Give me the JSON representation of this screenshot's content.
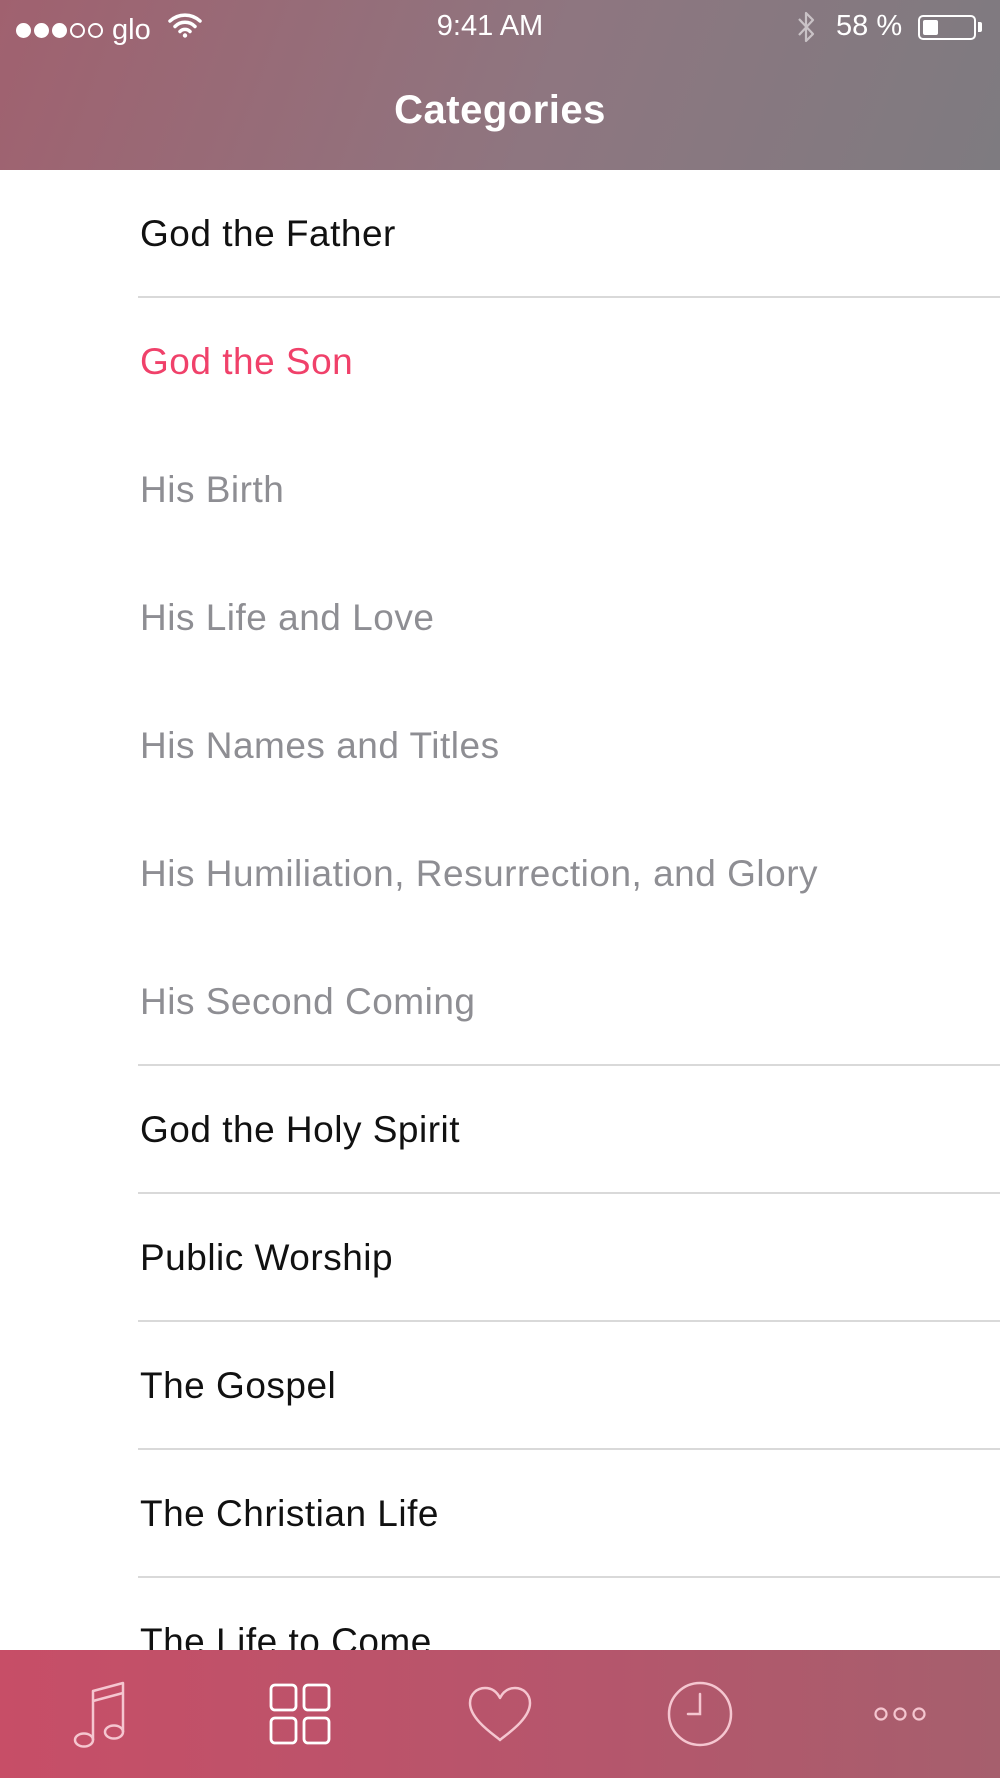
{
  "status_bar": {
    "carrier": "glo",
    "time": "9:41 AM",
    "battery_percent": "58 %",
    "battery_level": 0.58,
    "signal_strength": 3,
    "signal_max": 5
  },
  "header": {
    "title": "Categories"
  },
  "categories": [
    {
      "label": "God the Father"
    },
    {
      "label": "God the Son",
      "selected": true
    },
    {
      "label": "His Birth",
      "subcategory": true
    },
    {
      "label": "His Life and Love",
      "subcategory": true
    },
    {
      "label": "His Names and Titles",
      "subcategory": true
    },
    {
      "label": "His Humiliation, Resurrection, and Glory",
      "subcategory": true
    },
    {
      "label": "His Second Coming",
      "subcategory": true
    },
    {
      "label": "God the Holy Spirit"
    },
    {
      "label": "Public Worship"
    },
    {
      "label": "The Gospel"
    },
    {
      "label": "The Christian Life"
    },
    {
      "label": "The Life to Come"
    }
  ],
  "tab_bar": {
    "items": [
      {
        "icon": "music-note-icon"
      },
      {
        "icon": "grid-icon",
        "active": true
      },
      {
        "icon": "heart-icon"
      },
      {
        "icon": "clock-icon"
      },
      {
        "icon": "more-icon"
      }
    ]
  },
  "colors": {
    "selected": "#f0416a",
    "subcategory": "#8e8e93",
    "tab_bar": "#c04f66"
  }
}
